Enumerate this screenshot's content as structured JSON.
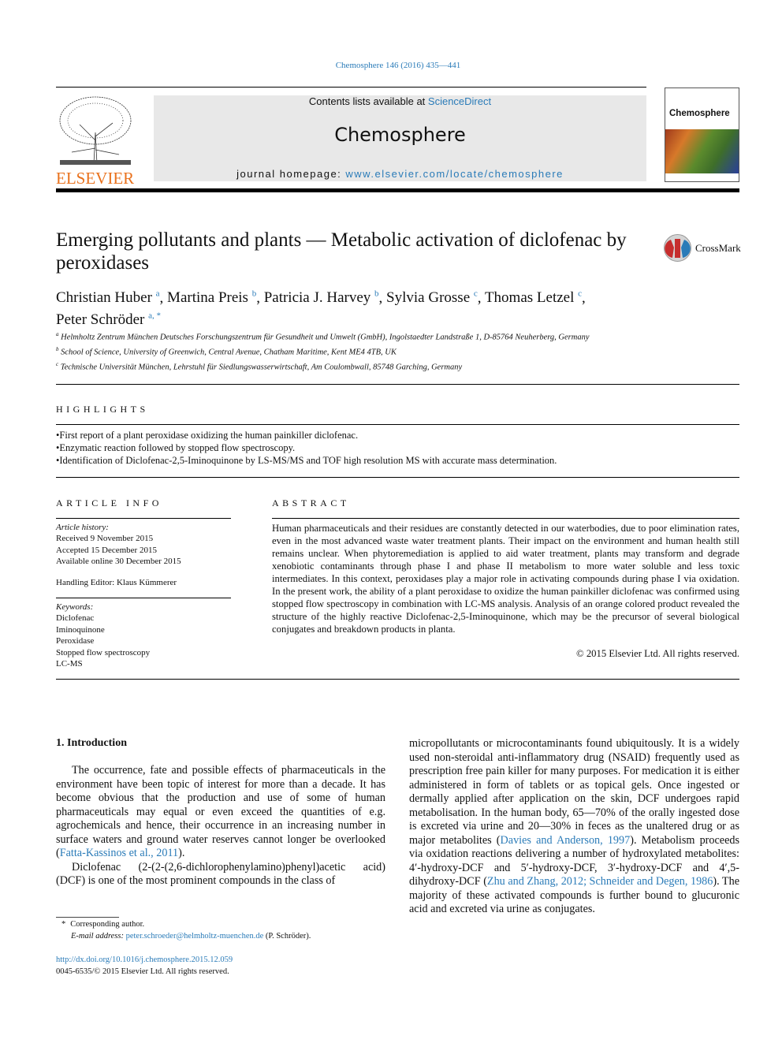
{
  "header": {
    "journal_ref": "Chemosphere 146 (2016) 435—441",
    "contents_prefix": "Contents lists available at ",
    "contents_link": "ScienceDirect",
    "journal_name": "Chemosphere",
    "homepage_prefix": "journal homepage: ",
    "homepage_link": "www.elsevier.com/locate/chemosphere",
    "publisher_logo": "ELSEVIER",
    "cover_title": "Chemosphere",
    "crossmark": "CrossMark",
    "accent_color": "#2a7bb8",
    "elsevier_color": "#e9711c"
  },
  "article": {
    "title": "Emerging pollutants and plants — Metabolic activation of diclofenac by peroxidases",
    "authors": [
      {
        "name": "Christian Huber",
        "sup": "a"
      },
      {
        "name": "Martina Preis",
        "sup": "b"
      },
      {
        "name": "Patricia J. Harvey",
        "sup": "b"
      },
      {
        "name": "Sylvia Grosse",
        "sup": "c"
      },
      {
        "name": "Thomas Letzel",
        "sup": "c"
      },
      {
        "name": "Peter Schröder",
        "sup": "a, *"
      }
    ],
    "affiliations": [
      {
        "sup": "a",
        "text": "Helmholtz Zentrum München Deutsches Forschungszentrum für Gesundheit und Umwelt (GmbH), Ingolstaedter Landstraße 1, D-85764 Neuherberg, Germany"
      },
      {
        "sup": "b",
        "text": "School of Science, University of Greenwich, Central Avenue, Chatham Maritime, Kent ME4 4TB, UK"
      },
      {
        "sup": "c",
        "text": "Technische Universität München, Lehrstuhl für Siedlungswasserwirtschaft, Am Coulombwall, 85748 Garching, Germany"
      }
    ]
  },
  "highlights": {
    "heading": "HIGHLIGHTS",
    "items": [
      "First report of a plant peroxidase oxidizing the human painkiller diclofenac.",
      "Enzymatic reaction followed by stopped flow spectroscopy.",
      "Identification of Diclofenac-2,5-Iminoquinone by LS-MS/MS and TOF high resolution MS with accurate mass determination."
    ]
  },
  "article_info": {
    "heading": "ARTICLE INFO",
    "history_label": "Article history:",
    "history": [
      "Received 9 November 2015",
      "Accepted 15 December 2015",
      "Available online 30 December 2015"
    ],
    "editor": "Handling Editor: Klaus Kümmerer",
    "keywords_label": "Keywords:",
    "keywords": [
      "Diclofenac",
      "Iminoquinone",
      "Peroxidase",
      "Stopped flow spectroscopy",
      "LC-MS"
    ]
  },
  "abstract": {
    "heading": "ABSTRACT",
    "text": "Human pharmaceuticals and their residues are constantly detected in our waterbodies, due to poor elimination rates, even in the most advanced waste water treatment plants. Their impact on the envi­ronment and human health still remains unclear. When phytoremediation is applied to aid water treatment, plants may transform and degrade xenobiotic contaminants through phase I and phase II metabolism to more water soluble and less toxic intermediates. In this context, peroxidases play a major role in activating compounds during phase I via oxidation. In the present work, the ability of a plant peroxidase to oxidize the human painkiller diclofenac was confirmed using stopped flow spectroscopy in combination with LC-MS analysis. Analysis of an orange colored product revealed the structure of the highly reactive Diclofenac-2,5-Iminoquinone, which may be the precursor of several biological conju­gates and breakdown products in planta.",
    "copyright": "© 2015 Elsevier Ltd. All rights reserved."
  },
  "body": {
    "section_heading": "1.  Introduction",
    "p1": "The occurrence, fate and possible effects of pharmaceuticals in the environment have been topic of interest for more than a decade. It has become obvious that the production and use of some of human pharmaceuticals may equal or even exceed the quantities of e.g. agrochemicals and hence, their occurrence in an increasing number in surface waters and ground water reserves cannot longer be overlooked (",
    "p1_cite": "Fatta-Kassinos et al., 2011",
    "p1_end": ").",
    "p2": "Diclofenac (2-(2-(2,6-dichlorophenylamino)phenyl)acetic acid) (DCF) is one of the most prominent compounds in the class of",
    "right_1": "micropollutants or microcontaminants found ubiquitously. It is a widely used non-steroidal anti-inflammatory drug (NSAID) frequently used as prescription free pain killer for many purposes. For medication it is either administered in form of tablets or as topical gels. Once ingested or dermally applied after application on the skin, DCF undergoes rapid metabolisation. In the human body, 65—70% of the orally ingested dose is excreted via urine and 20—30% in feces as the unaltered drug or as major metabolites (",
    "right_cite1": "Davies and Anderson, 1997",
    "right_2": "). Metabolism proceeds via oxidation reactions delivering a number of hydroxylated metabolites: 4′-hy­droxy-DCF and 5′-hydroxy-DCF, 3′-hydroxy-DCF and 4′,5-dihydroxy-DCF (",
    "right_cite2": "Zhu and Zhang, 2012; Schneider and Degen, 1986",
    "right_3": "). The majority of these activated compounds is further bound to glucuronic acid and excreted via urine as conjugates."
  },
  "footnotes": {
    "corresponding": "Corresponding author.",
    "email_label": "E-mail address: ",
    "email": "peter.schroeder@helmholtz-muenchen.de",
    "email_suffix": " (P. Schröder).",
    "doi": "http://dx.doi.org/10.1016/j.chemosphere.2015.12.059",
    "issn": "0045-6535/© 2015 Elsevier Ltd. All rights reserved."
  }
}
